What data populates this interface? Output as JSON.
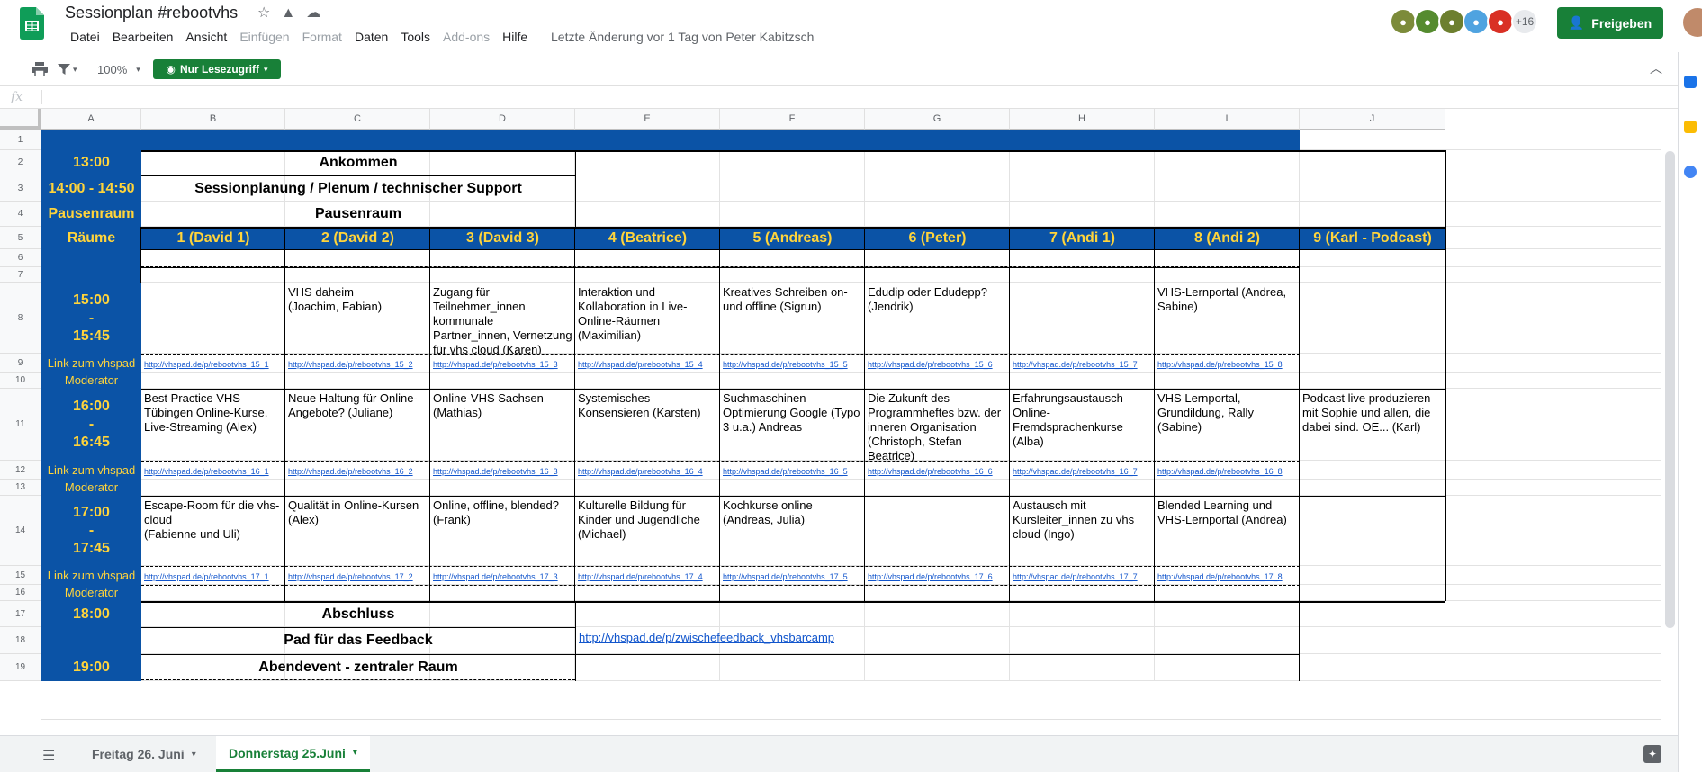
{
  "window": {
    "title": "Sessionplan #rebootvhs",
    "last_edit": "Letzte Änderung vor 1 Tag von Peter Kabitzsch",
    "menu": [
      "Datei",
      "Bearbeiten",
      "Ansicht",
      "Einfügen",
      "Format",
      "Daten",
      "Tools",
      "Add-ons",
      "Hilfe"
    ],
    "menu_disabled": [
      "Einfügen",
      "Format",
      "Add-ons"
    ],
    "share_label": "Freigeben",
    "collaborators_more": "+16",
    "brand_color": "#188038"
  },
  "toolbar": {
    "zoom": "100%",
    "readonly_label": "Nur Lesezugriff",
    "fx_label": "fx"
  },
  "grid": {
    "columns": [
      "A",
      "B",
      "C",
      "D",
      "E",
      "F",
      "G",
      "H",
      "I",
      "J"
    ],
    "rows": [
      "1",
      "2",
      "3",
      "4",
      "5",
      "6",
      "7",
      "8",
      "9",
      "10",
      "11",
      "12",
      "13",
      "14",
      "15",
      "16",
      "17",
      "18",
      "19"
    ],
    "header_color": "#0b53a6",
    "accent_text_color": "#ffd43b"
  },
  "schedule": {
    "r2_time": "13:00",
    "r2_event": "Ankommen",
    "r3_time": "14:00 - 14:50",
    "r3_event": "Sessionplanung / Plenum / technischer Support",
    "r4_label": "Pausenraum",
    "r4_event": "Pausenraum",
    "rooms_label": "Räume",
    "rooms": [
      "1 (David 1)",
      "2 (David 2)",
      "3 (David 3)",
      "4 (Beatrice)",
      "5 (Andreas)",
      "6 (Peter)",
      "7 (Andi 1)",
      "8 (Andi 2)",
      "9 (Karl - Podcast)"
    ],
    "link_label": "Link zum vhspad",
    "moderator_label": "Moderator",
    "slots": [
      {
        "start": "15:00",
        "dash": "-",
        "end": "15:45",
        "sessions": [
          "",
          "VHS daheim\n(Joachim, Fabian)",
          "Zugang für Teilnehmer_innen kommunale Partner_innen, Vernetzung für vhs cloud (Karen)",
          "Interaktion und Kollaboration in Live-Online-Räumen (Maximilian)",
          "Kreatives Schreiben on- und offline (Sigrun)",
          "Edudip oder Edudepp? (Jendrik)",
          "",
          "VHS-Lernportal (Andrea, Sabine)",
          ""
        ],
        "links": [
          "http://vhspad.de/p/rebootvhs_15_1",
          "http://vhspad.de/p/rebootvhs_15_2",
          "http://vhspad.de/p/rebootvhs_15_3",
          "http://vhspad.de/p/rebootvhs_15_4",
          "http://vhspad.de/p/rebootvhs_15_5",
          "http://vhspad.de/p/rebootvhs_15_6",
          "http://vhspad.de/p/rebootvhs_15_7",
          "http://vhspad.de/p/rebootvhs_15_8",
          ""
        ]
      },
      {
        "start": "16:00",
        "dash": "-",
        "end": "16:45",
        "sessions": [
          "Best Practice VHS Tübingen Online-Kurse, Live-Streaming (Alex)",
          "Neue Haltung für Online-Angebote? (Juliane)",
          "Online-VHS Sachsen (Mathias)",
          "Systemisches Konsensieren (Karsten)",
          "Suchmaschinen Optimierung Google (Typo 3 u.a.) Andreas",
          "Die Zukunft des Programmheftes bzw. der inneren Organisation (Christoph, Stefan Beatrice)",
          "Erfahrungsaustausch Online-Fremdsprachenkurse (Alba)",
          "VHS Lernportal, Grundildung, Rally (Sabine)",
          "Podcast live produzieren mit Sophie und allen, die dabei sind. OE... (Karl)"
        ],
        "links": [
          "http://vhspad.de/p/rebootvhs_16_1",
          "http://vhspad.de/p/rebootvhs_16_2",
          "http://vhspad.de/p/rebootvhs_16_3",
          "http://vhspad.de/p/rebootvhs_16_4",
          "http://vhspad.de/p/rebootvhs_16_5",
          "http://vhspad.de/p/rebootvhs_16_6",
          "http://vhspad.de/p/rebootvhs_16_7",
          "http://vhspad.de/p/rebootvhs_16_8",
          ""
        ]
      },
      {
        "start": "17:00",
        "dash": "-",
        "end": "17:45",
        "sessions": [
          "Escape-Room für die vhs-cloud\n(Fabienne und Uli)",
          "Qualität in Online-Kursen (Alex)",
          "Online, offline, blended? (Frank)",
          "Kulturelle Bildung für Kinder und Jugendliche (Michael)",
          "Kochkurse online\n(Andreas, Julia)",
          "",
          "Austausch mit Kursleiter_innen zu vhs cloud (Ingo)",
          "Blended Learning und VHS-Lernportal (Andrea)",
          ""
        ],
        "links": [
          "http://vhspad.de/p/rebootvhs_17_1",
          "http://vhspad.de/p/rebootvhs_17_2",
          "http://vhspad.de/p/rebootvhs_17_3",
          "http://vhspad.de/p/rebootvhs_17_4",
          "http://vhspad.de/p/rebootvhs_17_5",
          "http://vhspad.de/p/rebootvhs_17_6",
          "http://vhspad.de/p/rebootvhs_17_7",
          "http://vhspad.de/p/rebootvhs_17_8",
          ""
        ]
      }
    ],
    "r17_time": "18:00",
    "r17_event": "Abschluss",
    "r18_event": "Pad für das Feedback",
    "r18_link": "http://vhspad.de/p/zwischefeedback_vhsbarcamp",
    "r19_time": "19:00",
    "r19_event": "Abendevent - zentraler Raum"
  },
  "tabs": [
    {
      "label": "Freitag 26. Juni",
      "active": false
    },
    {
      "label": "Donnerstag 25.Juni",
      "active": true
    }
  ]
}
